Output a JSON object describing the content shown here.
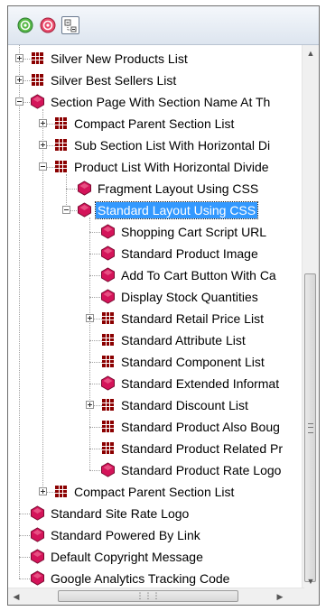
{
  "toolbar": {
    "buttons": [
      {
        "icon": "add-green-icon"
      },
      {
        "icon": "remove-red-icon"
      },
      {
        "icon": "collapse-all-icon"
      }
    ]
  },
  "tree": {
    "rows": [
      {
        "label": "Silver New Products List",
        "icon": "list-table-icon",
        "expander": "plus"
      },
      {
        "label": "Silver Best Sellers List",
        "icon": "list-table-icon",
        "expander": "plus"
      },
      {
        "label": "Section Page With Section Name At Th",
        "icon": "layout-hex-icon",
        "expander": "minus"
      },
      {
        "label": "Compact Parent Section List",
        "icon": "list-table-icon",
        "expander": "plus"
      },
      {
        "label": "Sub Section List With Horizontal Di",
        "icon": "list-table-icon",
        "expander": "plus"
      },
      {
        "label": "Product List With Horizontal Divide",
        "icon": "list-table-icon",
        "expander": "minus"
      },
      {
        "label": "Fragment Layout Using CSS",
        "icon": "layout-hex-icon",
        "expander": "none"
      },
      {
        "label": "Standard Layout Using CSS",
        "icon": "layout-hex-icon",
        "expander": "minus",
        "selected": true
      },
      {
        "label": "Shopping Cart Script URL",
        "icon": "layout-hex-icon",
        "expander": "none"
      },
      {
        "label": "Standard Product Image",
        "icon": "layout-hex-icon",
        "expander": "none"
      },
      {
        "label": "Add To Cart Button With Ca",
        "icon": "layout-hex-icon",
        "expander": "none"
      },
      {
        "label": "Display Stock Quantities",
        "icon": "layout-hex-icon",
        "expander": "none"
      },
      {
        "label": "Standard Retail Price List",
        "icon": "list-table-icon",
        "expander": "plus"
      },
      {
        "label": "Standard Attribute List",
        "icon": "list-table-icon",
        "expander": "none"
      },
      {
        "label": "Standard Component List",
        "icon": "list-table-icon",
        "expander": "none"
      },
      {
        "label": "Standard Extended Informat",
        "icon": "layout-hex-icon",
        "expander": "none"
      },
      {
        "label": "Standard Discount List",
        "icon": "list-table-icon",
        "expander": "plus"
      },
      {
        "label": "Standard Product Also Boug",
        "icon": "list-table-icon",
        "expander": "none"
      },
      {
        "label": "Standard Product Related Pr",
        "icon": "list-table-icon",
        "expander": "none"
      },
      {
        "label": "Standard Product Rate Logo",
        "icon": "layout-hex-icon",
        "expander": "none"
      },
      {
        "label": "Compact Parent Section List",
        "icon": "list-table-icon",
        "expander": "plus"
      },
      {
        "label": "Standard Site Rate Logo",
        "icon": "layout-hex-icon",
        "expander": "none"
      },
      {
        "label": "Standard Powered By Link",
        "icon": "layout-hex-icon",
        "expander": "none"
      },
      {
        "label": "Default Copyright Message",
        "icon": "layout-hex-icon",
        "expander": "none"
      },
      {
        "label": "Google Analytics Tracking Code",
        "icon": "layout-hex-icon",
        "expander": "none"
      }
    ]
  },
  "scrollbars": {
    "vertical_position": 0.66,
    "horizontal_position": 0.2
  },
  "colors": {
    "selection": "#3399ff",
    "hex_icon": "#d4145a",
    "table_icon": "#8b0000"
  }
}
